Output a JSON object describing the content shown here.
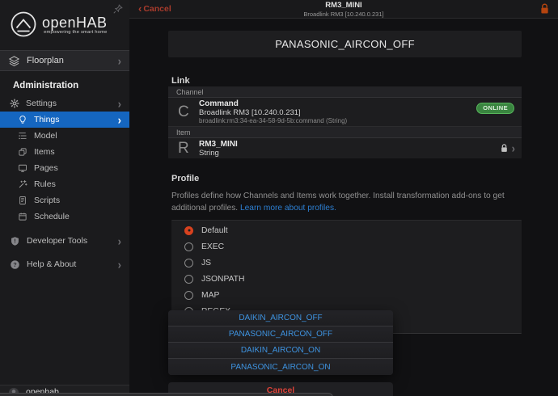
{
  "navbar": {
    "cancel_label": "Cancel",
    "title": "RM3_MINI",
    "subtitle": "Broadlink RM3 [10.240.0.231]",
    "lock_icon": "lock-icon",
    "lock_color": "#b5440f"
  },
  "sidebar": {
    "logo_text": "openHAB",
    "logo_tagline": "empowering the smart home",
    "pin_icon": "pin-icon",
    "floorplan": {
      "label": "Floorplan",
      "icon": "layers-icon"
    },
    "section_label": "Administration",
    "settings": {
      "label": "Settings",
      "icon": "gear-icon"
    },
    "settings_items": [
      {
        "label": "Things",
        "icon": "lightbulb-icon",
        "selected": true
      },
      {
        "label": "Model",
        "icon": "model-tree-icon",
        "selected": false
      },
      {
        "label": "Items",
        "icon": "copy-icon",
        "selected": false
      },
      {
        "label": "Pages",
        "icon": "display-icon",
        "selected": false
      },
      {
        "label": "Rules",
        "icon": "wand-icon",
        "selected": false
      },
      {
        "label": "Scripts",
        "icon": "document-icon",
        "selected": false
      },
      {
        "label": "Schedule",
        "icon": "calendar-icon",
        "selected": false
      }
    ],
    "developer_tools": {
      "label": "Developer Tools",
      "icon": "shield-icon"
    },
    "help_about": {
      "label": "Help & About",
      "icon": "question-icon"
    },
    "user": {
      "label": "openhab",
      "icon": "avatar"
    }
  },
  "main": {
    "page_title": "PANASONIC_AIRCON_OFF",
    "link_section": {
      "header": "Link",
      "channel_label": "Channel",
      "channel": {
        "name": "Command",
        "thing": "Broadlink RM3 [10.240.0.231]",
        "uid": "broadlink:rm3:34-ea-34-58-9d-5b:command (String)",
        "status": "ONLINE",
        "status_color": "#4cae50"
      },
      "item_label": "Item",
      "item": {
        "name": "RM3_MINI",
        "type": "String"
      }
    },
    "profile_section": {
      "header": "Profile",
      "description": "Profiles define how Channels and Items work together. Install transformation add-ons to get additional profiles. ",
      "link_text": "Learn more about profiles.",
      "options": [
        {
          "label": "Default",
          "selected": true
        },
        {
          "label": "EXEC",
          "selected": false
        },
        {
          "label": "JS",
          "selected": false
        },
        {
          "label": "JSONPATH",
          "selected": false
        },
        {
          "label": "MAP",
          "selected": false
        },
        {
          "label": "REGEX",
          "selected": false
        }
      ]
    }
  },
  "action_sheet": {
    "options": [
      "DAIKIN_AIRCON_OFF",
      "PANASONIC_AIRCON_OFF",
      "DAIKIN_AIRCON_ON",
      "PANASONIC_AIRCON_ON"
    ],
    "cancel_label": "Cancel"
  },
  "colors": {
    "accent_blue_row": "#1566c0",
    "radio_selected": "#d8421f",
    "link_blue": "#2d7fd2",
    "sheet_blue": "#3e93e0",
    "cancel_red": "#de4238"
  }
}
